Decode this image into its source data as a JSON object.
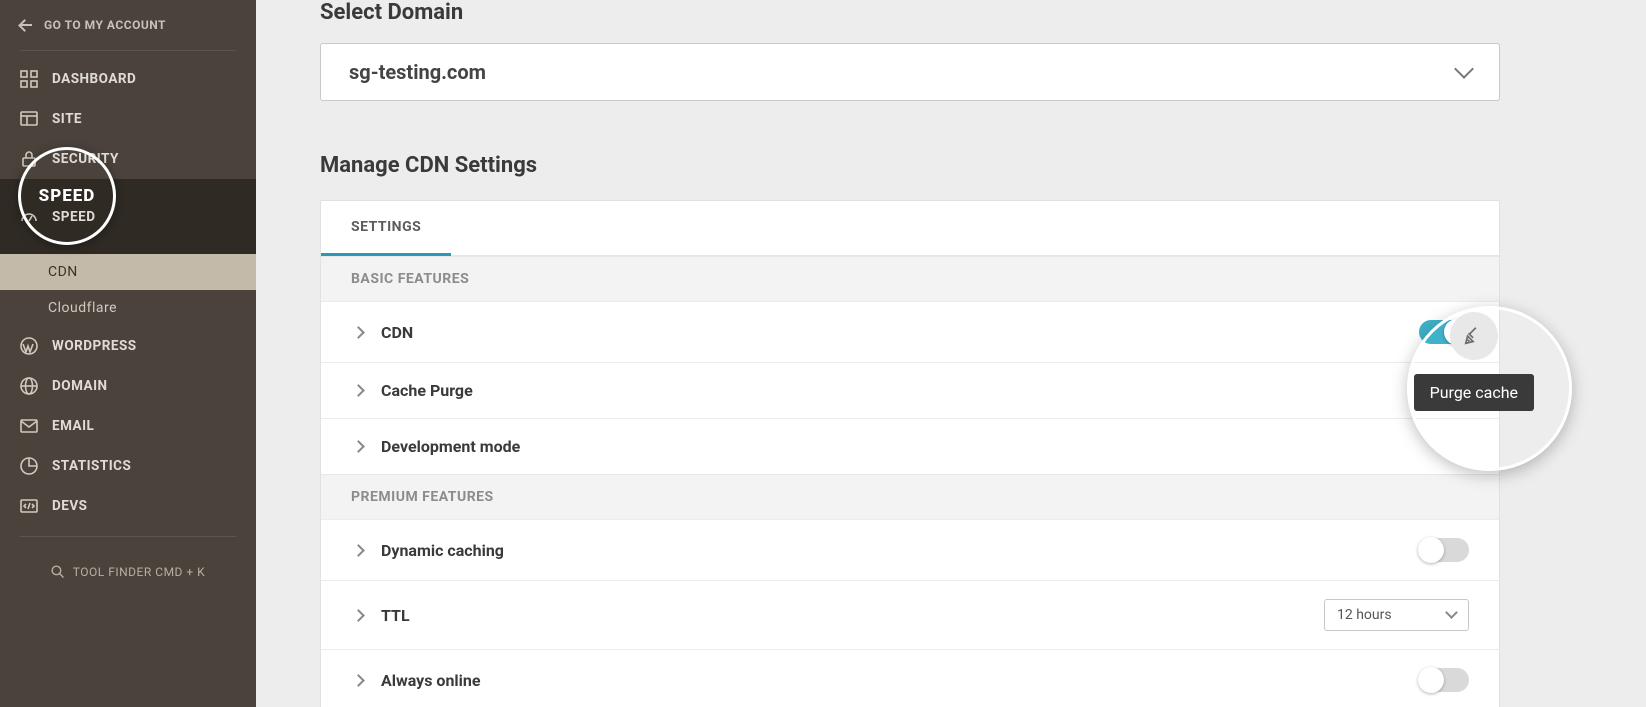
{
  "sidebar": {
    "back_label": "GO TO MY ACCOUNT",
    "items": [
      {
        "label": "DASHBOARD"
      },
      {
        "label": "SITE"
      },
      {
        "label": "SECURITY"
      },
      {
        "label": "SPEED"
      },
      {
        "label": "WORDPRESS"
      },
      {
        "label": "DOMAIN"
      },
      {
        "label": "EMAIL"
      },
      {
        "label": "STATISTICS"
      },
      {
        "label": "DEVS"
      }
    ],
    "speed_sub": [
      {
        "label": "CDN"
      },
      {
        "label": "Cloudflare"
      }
    ],
    "tool_finder": "TOOL FINDER CMD + K"
  },
  "main": {
    "select_domain_title": "Select Domain",
    "selected_domain": "sg-testing.com",
    "manage_title": "Manage CDN Settings",
    "tab_settings": "SETTINGS",
    "group_basic": "BASIC FEATURES",
    "group_premium": "PREMIUM FEATURES",
    "rows": {
      "cdn": {
        "label": "CDN",
        "on": true
      },
      "cache_purge": {
        "label": "Cache Purge"
      },
      "dev_mode": {
        "label": "Development mode"
      },
      "dynamic_caching": {
        "label": "Dynamic caching",
        "on": false
      },
      "ttl": {
        "label": "TTL",
        "value": "12 hours"
      },
      "always_online": {
        "label": "Always online",
        "on": false
      }
    },
    "purge_tooltip": "Purge cache"
  },
  "highlight": {
    "speed_badge": "SPEED"
  }
}
